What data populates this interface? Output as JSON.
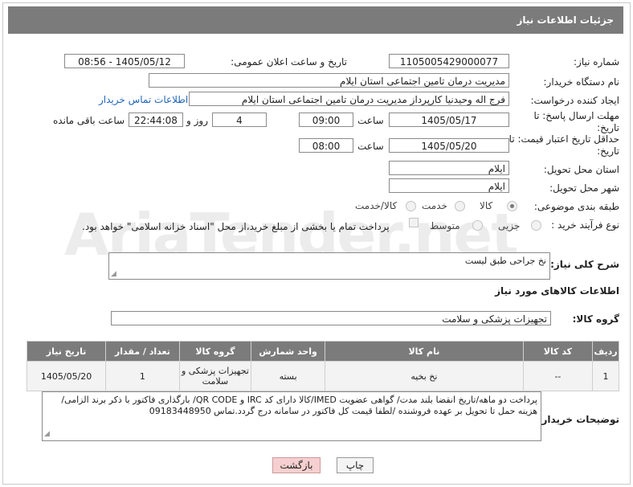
{
  "header": {
    "title": "جزئیات اطلاعات نیاز"
  },
  "watermark": "AriaTender.net",
  "fields": {
    "need_number_label": "شماره نیاز:",
    "need_number": "1105005429000077",
    "announce_label": "تاریخ و ساعت اعلان عمومی:",
    "announce_value": "1405/05/12 - 08:56",
    "buyer_org_label": "نام دستگاه خریدار:",
    "buyer_org": "مدیریت درمان تامین اجتماعی استان ایلام",
    "creator_label": "ایجاد کننده درخواست:",
    "creator": "فرج اله وحیدنیا کارپرداز مدیریت درمان تامین اجتماعی استان ایلام",
    "contact_link": "اطلاعات تماس خریدار",
    "reply_deadline_label": "مهلت ارسال پاسخ: تا تاریخ:",
    "reply_date": "1405/05/17",
    "time_label": "ساعت",
    "reply_time": "09:00",
    "days_value": "4",
    "days_label": "روز و",
    "remaining_time": "22:44:08",
    "remaining_label": "ساعت باقی مانده",
    "price_validity_label": "حداقل تاریخ اعتبار قیمت: تا تاریخ:",
    "price_date": "1405/05/20",
    "price_time": "08:00",
    "province_label": "استان محل تحویل:",
    "province": "ایلام",
    "city_label": "شهر محل تحویل:",
    "city": "ایلام",
    "category_label": "طبقه بندی موضوعی:",
    "category_options": [
      "کالا",
      "خدمت",
      "کالا/خدمت"
    ],
    "category_selected": "کالا",
    "process_label": "نوع فرآیند خرید :",
    "process_options": [
      "جزیی",
      "متوسط"
    ],
    "process_note": "پرداخت تمام یا بخشی از مبلغ خرید،از محل \"اسناد خزانه اسلامی\" خواهد بود.",
    "description_label": "شرح کلی نیاز:",
    "description": "نخ جراحی طبق لیست",
    "goods_info_title": "اطلاعات کالاهای مورد نیاز",
    "goods_group_label": "گروه کالا:",
    "goods_group": "تجهیزات پزشکی و سلامت",
    "notes_label": "توضیحات خریدار:",
    "notes": "پرداخت دو ماهه/تاریخ انقضا بلند مدت/ گواهی عضویت IMED/کالا دارای کد IRC  و QR CODE/ بارگذاری فاکتور با ذکر برند الزامی/ هزینه حمل تا تحویل بر عهده فروشنده /لطفا قیمت کل فاکتور در سامانه درج گردد.تماس 09183448950"
  },
  "table": {
    "headers": [
      "ردیف",
      "کد کالا",
      "نام کالا",
      "واحد شمارش",
      "گروه کالا",
      "تعداد / مقدار",
      "تاریخ نیاز"
    ],
    "rows": [
      [
        "1",
        "--",
        "نخ بخیه",
        "بسته",
        "تجهیزات پزشکی و سلامت",
        "1",
        "1405/05/20"
      ]
    ]
  },
  "buttons": {
    "print": "چاپ",
    "back": "بازگشت"
  },
  "colors": {
    "header_bg": "#7b7b7b",
    "link": "#2266bb",
    "back_btn_bg": "#f6d0d0"
  }
}
